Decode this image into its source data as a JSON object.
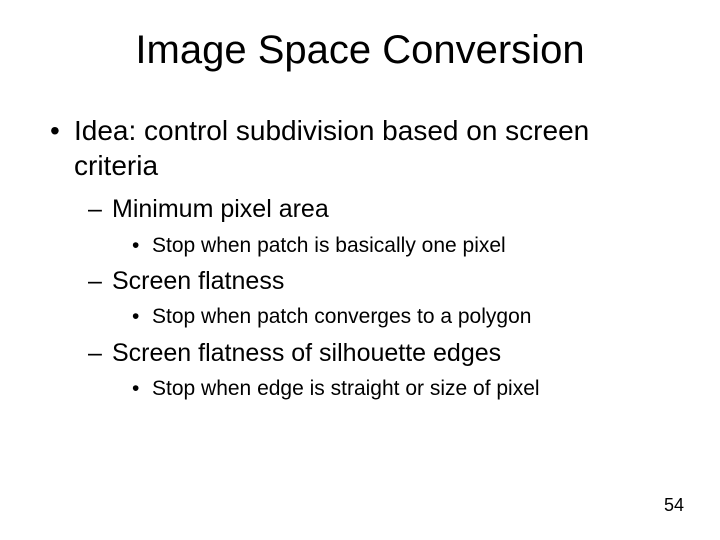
{
  "title": "Image Space Conversion",
  "bullets": {
    "l1": "Idea: control subdivision based on screen criteria",
    "l2a": "Minimum pixel area",
    "l3a": "Stop when patch is basically one pixel",
    "l2b": "Screen flatness",
    "l3b": "Stop when patch converges to a polygon",
    "l2c": "Screen flatness of silhouette edges",
    "l3c": "Stop when edge is straight or size of pixel"
  },
  "page_number": "54"
}
